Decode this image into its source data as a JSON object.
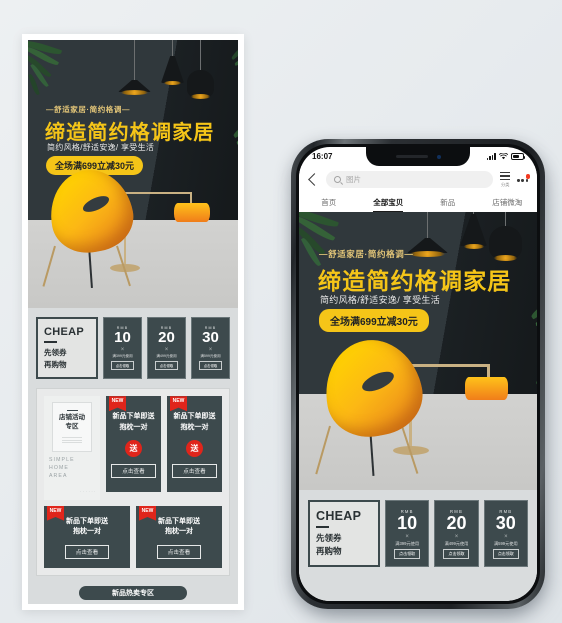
{
  "hero": {
    "eyebrow": "—舒适家居·简约格调—",
    "title": "缔造简约格调家居",
    "subtitle": "简约风格/舒适安逸/ 享受生活",
    "badge": "全场满699立减30元",
    "accent_color": "#f5c518",
    "bg_color": "#30383c"
  },
  "coupon_section": {
    "cheap": {
      "title": "CHEAP",
      "line1": "先领券",
      "line2": "再购物"
    },
    "coupons": [
      {
        "currency": "RMB",
        "amount": "10",
        "divider": "×",
        "condition": "满399元使用",
        "button": "点击领取"
      },
      {
        "currency": "RMB",
        "amount": "20",
        "divider": "×",
        "condition": "满499元使用",
        "button": "点击领取"
      },
      {
        "currency": "RMB",
        "amount": "30",
        "divider": "×",
        "condition": "满599元使用",
        "button": "点击领取"
      }
    ]
  },
  "store_card": {
    "title_line1": "店铺活动",
    "title_line2": "专区",
    "english_line1": "SIMPLE HOME",
    "english_line2": "AREA",
    "dots": "······"
  },
  "product_cards": {
    "tall": [
      {
        "flag": "NEW",
        "line1": "新品下单即送",
        "line2": "抱枕一对",
        "gift": "送",
        "button": "点击查看"
      },
      {
        "flag": "NEW",
        "line1": "新品下单即送",
        "line2": "抱枕一对",
        "gift": "送",
        "button": "点击查看"
      }
    ],
    "short": [
      {
        "flag": "NEW",
        "line1": "新品下单即送",
        "line2": "抱枕一对",
        "button": "点击查看"
      },
      {
        "flag": "NEW",
        "line1": "新品下单即送",
        "line2": "抱枕一对",
        "button": "点击查看"
      }
    ]
  },
  "bottom_banner": {
    "label": "新品热卖专区"
  },
  "phone": {
    "status": {
      "time": "16:07"
    },
    "search": {
      "placeholder": "图片"
    },
    "category_label": "分类",
    "tabs": [
      {
        "label": "首页",
        "active": false
      },
      {
        "label": "全部宝贝",
        "active": true
      },
      {
        "label": "新品",
        "active": false
      },
      {
        "label": "店铺微淘",
        "active": false
      }
    ]
  }
}
